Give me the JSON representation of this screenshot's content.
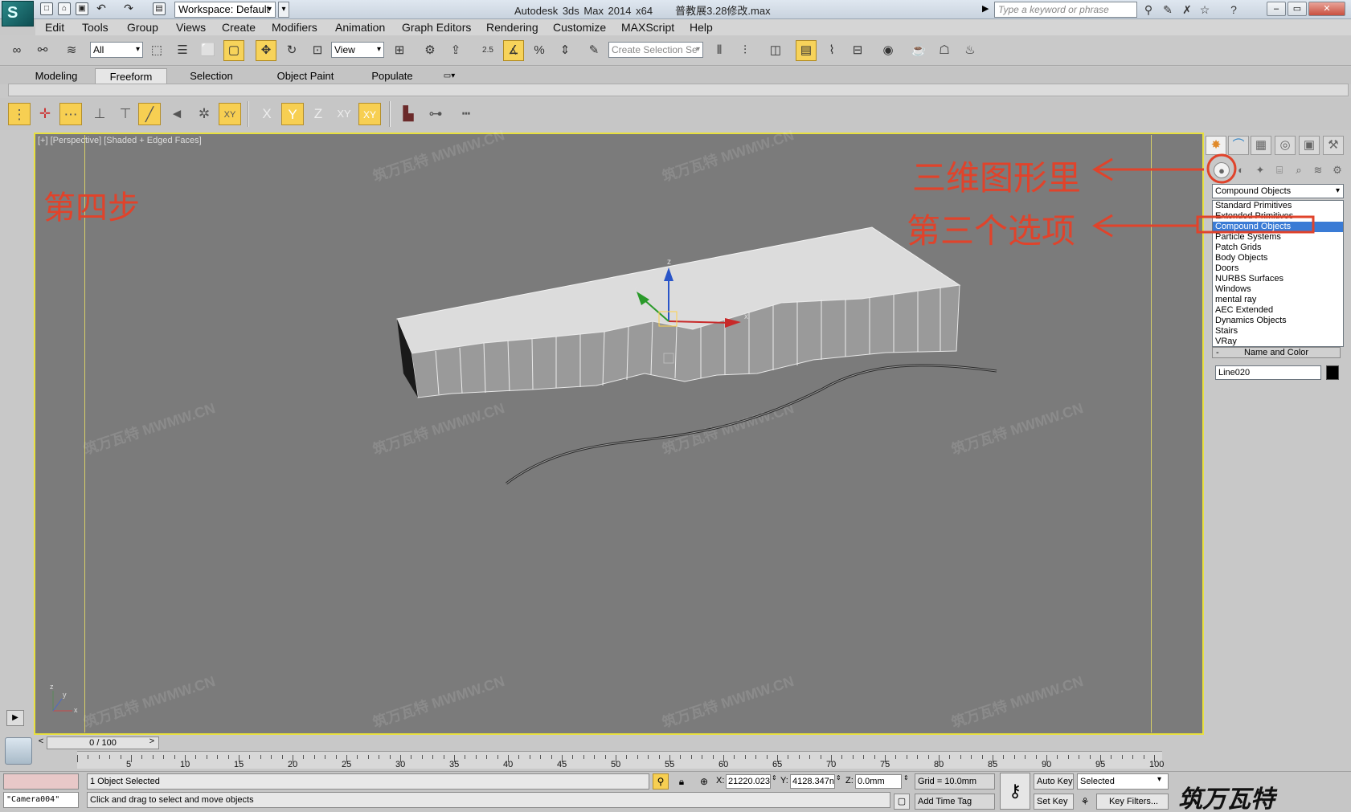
{
  "title_bar": {
    "app_title": "Autodesk 3ds Max  2014 x64",
    "file_name": "普教展3.28修改.max",
    "workspace_value": "Workspace: Default",
    "search_placeholder": "Type a keyword or phrase"
  },
  "menu": [
    "Edit",
    "Tools",
    "Group",
    "Views",
    "Create",
    "Modifiers",
    "Animation",
    "Graph Editors",
    "Rendering",
    "Customize",
    "MAXScript",
    "Help"
  ],
  "toolbar": {
    "selection_filter": "All",
    "reference_coord": "View",
    "named_selection_placeholder": "Create Selection Se",
    "snap_angle_label": "2.5"
  },
  "ribbon_tabs": [
    "Modeling",
    "Freeform",
    "Selection",
    "Object Paint",
    "Populate"
  ],
  "axis_labels": {
    "x": "X",
    "y": "Y",
    "z": "Z",
    "xy": "XY",
    "xy2": "XY"
  },
  "viewport": {
    "label": "[+] [Perspective] [Shaded + Edged Faces]",
    "watermark_text": "MWMW.CN",
    "watermark_cn": "筑万瓦特",
    "gizmo": {
      "x": "x",
      "y": "y",
      "z": "z"
    }
  },
  "annotations": {
    "step": "第四步",
    "hint_1": "三维图形里",
    "hint_2": "第三个选项"
  },
  "command_panel": {
    "dropdown_value": "Compound Objects",
    "dropdown_items": [
      "Standard Primitives",
      "Extended Primitives",
      "Compound Objects",
      "Particle Systems",
      "Patch Grids",
      "Body Objects",
      "Doors",
      "NURBS Surfaces",
      "Windows",
      "mental ray",
      "AEC Extended",
      "Dynamics Objects",
      "Stairs",
      "VRay"
    ],
    "selected_index": 2,
    "rollout_title": "Name and Color",
    "rollout_toggle": "-",
    "object_name": "Line020",
    "object_color": "#000000"
  },
  "timeline": {
    "frame_display": "0 / 100",
    "ticks": [
      "5",
      "10",
      "15",
      "20",
      "25",
      "30",
      "35",
      "40",
      "45",
      "50",
      "55",
      "60",
      "65",
      "70",
      "75",
      "80",
      "85",
      "90",
      "95",
      "100"
    ]
  },
  "status": {
    "camera_name": "\"Camera004\"",
    "selection_info": "1 Object Selected",
    "prompt": "Click and drag to select and move objects",
    "x_label": "X:",
    "x_value": "21220.023",
    "y_label": "Y:",
    "y_value": "4128.347n",
    "z_label": "Z:",
    "z_value": "0.0mm",
    "grid": "Grid = 10.0mm",
    "add_time_tag": "Add Time Tag",
    "auto_key": "Auto Key",
    "set_key": "Set Key",
    "key_mode": "Selected",
    "key_filters": "Key Filters...",
    "brand": "筑万瓦特"
  }
}
